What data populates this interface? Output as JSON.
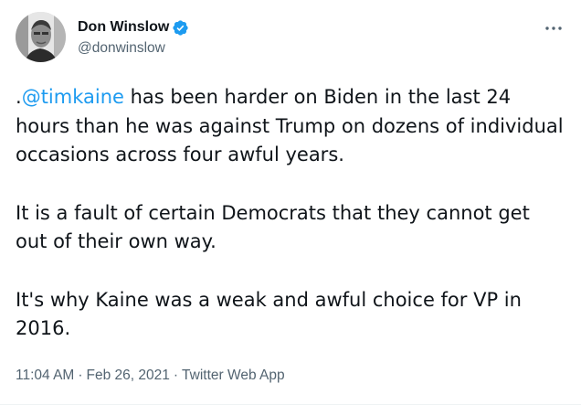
{
  "author": {
    "display_name": "Don Winslow",
    "handle": "@donwinslow"
  },
  "header": {
    "more_glyph": "···"
  },
  "tweet": {
    "p1_prefix": ".",
    "p1_mention": "@timkaine",
    "p1_rest": " has been harder on Biden in the last 24 hours than he was against Trump on dozens of individual occasions across four awful years.",
    "p2": "It is a fault of certain Democrats that they cannot get out of their own way.",
    "p3": "It's why Kaine was a weak and awful choice for VP in 2016."
  },
  "meta": {
    "time": "11:04 AM",
    "separator": "·",
    "date": "Feb 26, 2021",
    "source": "Twitter Web App"
  },
  "colors": {
    "accent": "#1d9bf0",
    "text": "#0f1419",
    "secondary": "#536471"
  }
}
